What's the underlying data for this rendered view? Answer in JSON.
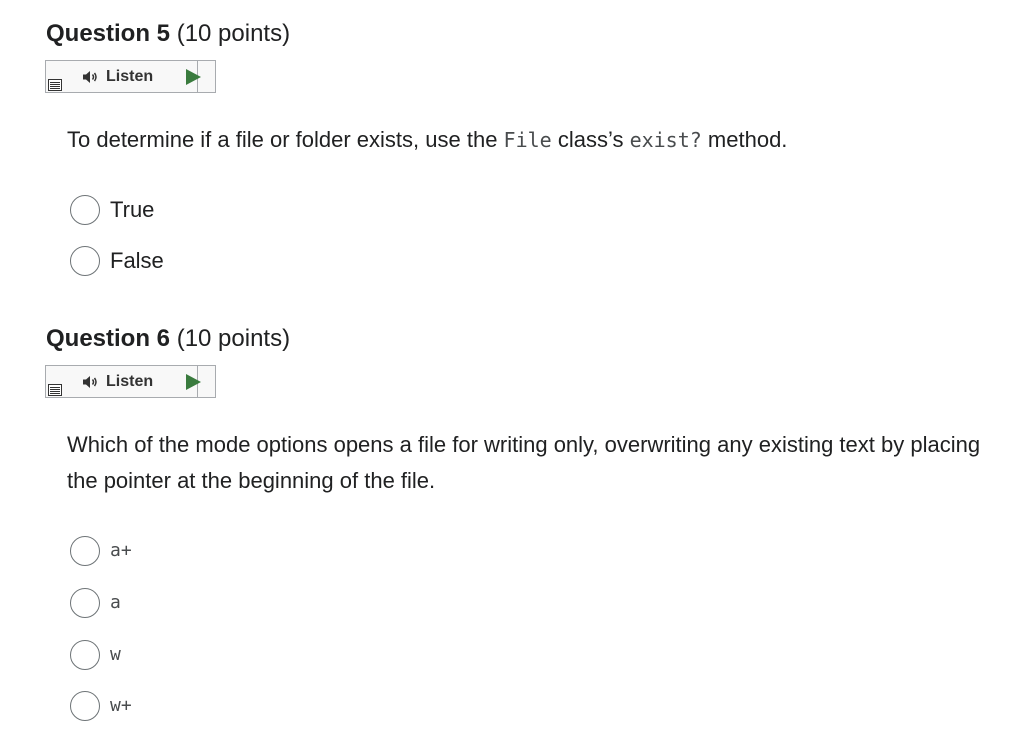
{
  "questions": [
    {
      "name": "Question 5",
      "points": "(10 points)",
      "listen_label": "Listen",
      "prompt": {
        "before": "To determine if a file or folder exists, use the ",
        "code1": "File",
        "middle": " class’s ",
        "code2": "exist?",
        "after": " method."
      },
      "options": [
        "True",
        "False"
      ]
    },
    {
      "name": "Question 6",
      "points": "(10 points)",
      "listen_label": "Listen",
      "prompt": {
        "text": "Which of the mode options opens a file for writing only, overwriting any existing text by placing the pointer at the beginning of the file."
      },
      "options": [
        "a+",
        "a",
        "w",
        "w+"
      ]
    }
  ],
  "colors": {
    "play_green": "#3a7b3e",
    "border_gray": "#a8abaf",
    "text_dark": "#202122"
  }
}
